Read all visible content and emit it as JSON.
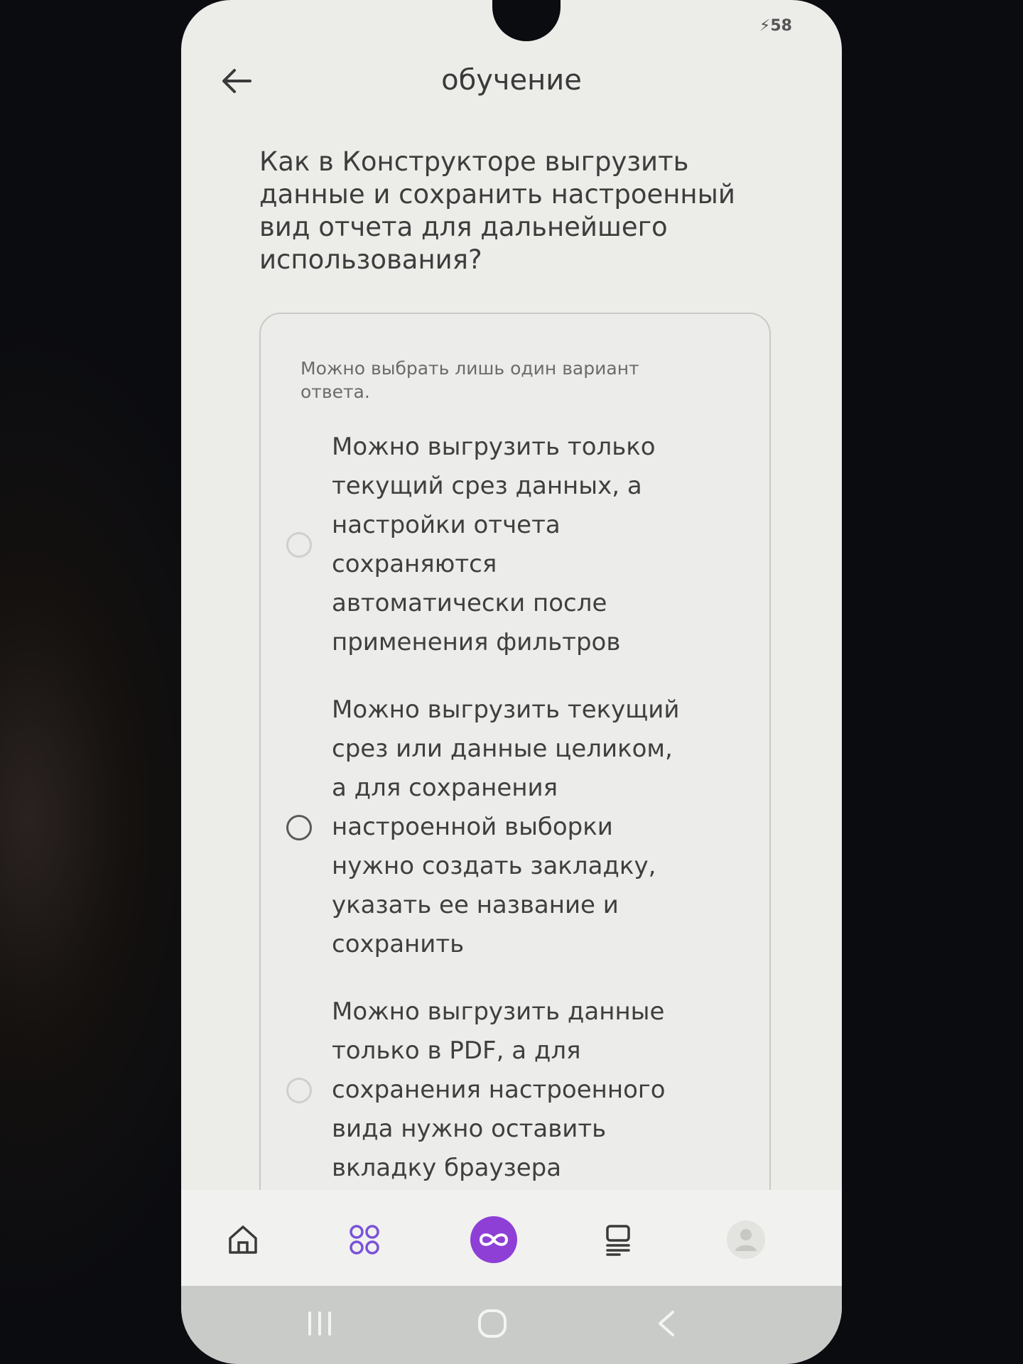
{
  "status_bar": {
    "battery": "58"
  },
  "header": {
    "title": "обучение",
    "back_icon": "arrow-left-icon"
  },
  "quiz": {
    "question": "Как в Конструкторе выгрузить данные и сохранить настроенный вид отчета для дальнейшего использования?",
    "hint": "Можно выбрать лишь один вариант ответа.",
    "options": [
      {
        "label": "Можно выгрузить только текущий срез данных, а настройки отчета сохраняются автоматически после применения фильтров",
        "selected": false
      },
      {
        "label": "Можно выгрузить текущий срез или данные целиком, а для сохранения настроенной выборки нужно создать закладку, указать ее название и сохранить",
        "selected": false
      },
      {
        "label": "Можно выгрузить данные только в PDF, а для сохранения настроенного вида нужно оставить вкладку браузера",
        "selected": false
      }
    ]
  },
  "bottom_nav": {
    "items": [
      {
        "icon": "home-icon"
      },
      {
        "icon": "grid-icon"
      },
      {
        "icon": "infinity-icon"
      },
      {
        "icon": "courses-icon"
      },
      {
        "icon": "profile-icon"
      }
    ],
    "accent_color": "#8e3fd6"
  },
  "system_nav": {
    "items": [
      {
        "icon": "recents-icon"
      },
      {
        "icon": "home-circle-icon"
      },
      {
        "icon": "back-chevron-icon"
      }
    ]
  }
}
